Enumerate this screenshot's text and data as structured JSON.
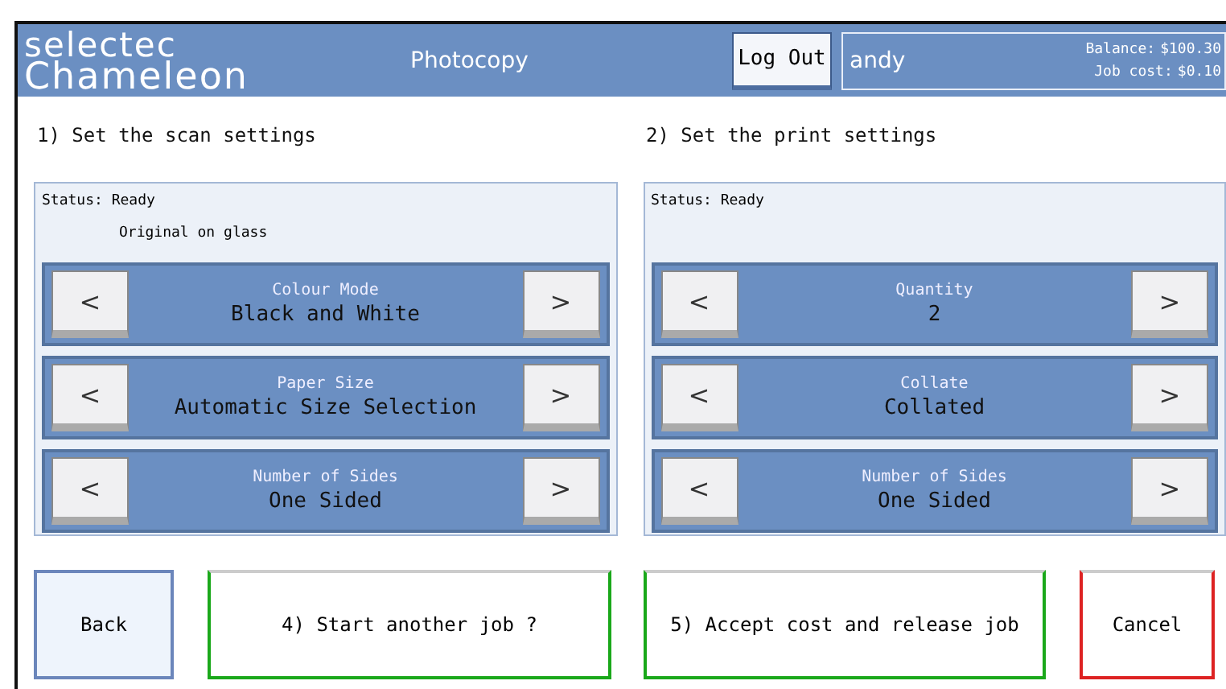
{
  "header": {
    "brand_line_1": "selectec",
    "brand_line_2": "Chameleon",
    "title": "Photocopy",
    "logout_button": "Log Out",
    "user": "andy",
    "balance_label": "Balance:",
    "balance": "$100.30",
    "job_cost_label": "Job cost:",
    "job_cost": "$0.10"
  },
  "sections": [
    {
      "heading": "1) Set the scan settings",
      "status": [
        "Status: Ready",
        "Original on glass"
      ],
      "settings": [
        {
          "label": "Colour Mode",
          "value": "Black and White",
          "prev": "<",
          "next": ">"
        },
        {
          "label": "Paper Size",
          "value": "Automatic Size Selection",
          "prev": "<",
          "next": ">"
        },
        {
          "label": "Number of Sides",
          "value": "One Sided",
          "prev": "<",
          "next": ">"
        }
      ]
    },
    {
      "heading": "2) Set the print settings",
      "status": [
        "Status: Ready"
      ],
      "settings": [
        {
          "label": "Quantity",
          "value": "2",
          "prev": "<",
          "next": ">"
        },
        {
          "label": "Collate",
          "value": "Collated",
          "prev": "<",
          "next": ">"
        },
        {
          "label": "Number of Sides",
          "value": "One Sided",
          "prev": "<",
          "next": ">"
        }
      ]
    }
  ],
  "actions": [
    {
      "label": "Back",
      "kind": "back"
    },
    {
      "label": "4) Start another job ?",
      "kind": "proceed"
    },
    {
      "label": "5) Accept cost and release job",
      "kind": "proceed"
    },
    {
      "label": "Cancel",
      "kind": "cancel"
    }
  ]
}
